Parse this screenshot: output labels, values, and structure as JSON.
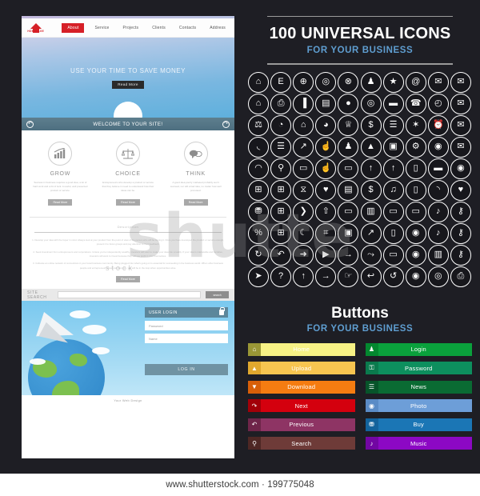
{
  "website": {
    "logo_text": "HOMEPAGE",
    "nav": [
      {
        "label": "About",
        "active": true
      },
      {
        "label": "Service",
        "active": false
      },
      {
        "label": "Projects",
        "active": false
      },
      {
        "label": "Clients",
        "active": false
      },
      {
        "label": "Contacts",
        "active": false
      },
      {
        "label": "Address",
        "active": false
      }
    ],
    "hero": {
      "title": "USE YOUR TIME TO SAVE MONEY",
      "button": "Read  More"
    },
    "welcome_bar": {
      "text": "WELCOME TO YOUR SITE!",
      "prev_icon": "arrow-left-circle-icon",
      "next_icon": "arrow-right-circle-icon"
    },
    "features": [
      {
        "title": "GROW",
        "icon": "bar-chart-growth-icon",
        "body": "Success in business requires a good idea, a lot of hard work and a bit of luck. A useful, well presented product or service.",
        "button": "Read More"
      },
      {
        "title": "CHOICE",
        "icon": "scales-balance-icon",
        "body": "Entrepreneurs who develop a product or service that they believe in need to understand how their ideas can be.",
        "button": "Read More"
      },
      {
        "title": "THINK",
        "icon": "speech-bubbles-icon",
        "body": "A good idea poorly marketed probably won't succeed, nor will a bad idea, no matter how well promoted.",
        "button": "Read More"
      }
    ],
    "article": {
      "heading": "Description",
      "paragraphs": [
        "1. Develop your idea with the buyer in mind. Always look at your product from the point of view of the person who will be buying it. Once you have developed the product or service enough, present it to focus groups and pay attention to their feedback.",
        "2. Seek investment from entrepreneurs and corporations. Unless you're independently wealthy, investors will want to make your idea into a reality. If your idea is marketable and lucrative, investors will want to invest because they will see profit in it for themselves.",
        "3. Cultivate an online network of connections in your local business community. Being plugged into what's going on is essential for succeeding in the business world. When other business people and entrepreneurs know and trust you, you will be in the loop when opportunities arise."
      ],
      "button": "Read More"
    },
    "site_search": {
      "label": "SITE  SEARCH",
      "input_value": "",
      "placeholder": "",
      "button": "search"
    },
    "login": {
      "header": "USER LOGIN",
      "lock_icon": "lock-icon",
      "password_placeholder": "Password",
      "name_placeholder": "Name",
      "submit": "LOG IN"
    },
    "footer": "Your  Web  Design"
  },
  "icons_section": {
    "title": "100 UNIVERSAL ICONS",
    "subtitle": "FOR YOUR BUSINESS",
    "accent_color": "#5f9ed1",
    "rows": [
      [
        "home-icon",
        "document-icon",
        "globe-grid-icon",
        "globe-icon",
        "globe-wire-icon",
        "users-group-icon",
        "award-badge-icon",
        "at-sign-icon",
        "mail-star-icon",
        "envelope-icon"
      ],
      [
        "home-alt-icon",
        "printer-doc-icon",
        "bar-chart-icon",
        "presentation-icon",
        "world-globe-icon",
        "target-icon",
        "briefcase-icon",
        "phone-icon",
        "clock-icon",
        "envelope-open-icon"
      ],
      [
        "scales-icon",
        "pie-doc-icon",
        "bank-icon",
        "pie-chart-icon",
        "trophy-icon",
        "money-bag-icon",
        "server-icon",
        "network-icon",
        "alarm-clock-icon",
        "mail-send-icon"
      ],
      [
        "rss-icon",
        "file-stack-icon",
        "rocket-launch-icon",
        "thumbs-up-icon",
        "user-tie-icon",
        "graduation-cap-icon",
        "photo-frame-icon",
        "gear-icon",
        "record-icon",
        "mail-plain-icon"
      ],
      [
        "wifi-icon",
        "search-doc-icon",
        "shopping-bag-icon",
        "thumb-up-alt-icon",
        "tv-icon",
        "rocket-icon",
        "missile-icon",
        "mobile-phone-icon",
        "bed-icon",
        "circle-dot-icon"
      ],
      [
        "gift-box-icon",
        "gift-icon",
        "hourglass-icon",
        "heart-icon",
        "bench-icon",
        "dollar-icon",
        "music-note-icon",
        "tablet-icon",
        "bathtub-icon",
        "heart-leaf-icon"
      ],
      [
        "shopping-cart-icon",
        "present-icon",
        "chevron-right-icon",
        "arrow-up-icon",
        "laptop-icon",
        "card-reader-icon",
        "monitor-icon",
        "notebook-icon",
        "headphones-icon",
        "key-icon"
      ],
      [
        "percent-icon",
        "gift-small-icon",
        "moon-icon",
        "grid-icon",
        "camera-square-icon",
        "arrow-diagonal-icon",
        "smartphone-icon",
        "camera-icon",
        "headset-icon",
        "key-alt-icon"
      ],
      [
        "refresh-icon",
        "undo-icon",
        "arrow-right-round-icon",
        "play-icon",
        "arrow-right-bar-icon",
        "arrow-curve-icon",
        "screen-icon",
        "photo-camera-icon",
        "cassette-icon",
        "key-hole-icon"
      ],
      [
        "cursor-icon",
        "question-icon",
        "arrow-up-line-icon",
        "arrow-right-line-icon",
        "hand-pointer-icon",
        "back-arrow-icon",
        "reload-icon",
        "camera-flash-icon",
        "video-camera-icon",
        "print-icon"
      ]
    ]
  },
  "buttons_section": {
    "title": "Buttons",
    "subtitle": "FOR YOUR BUSINESS",
    "left_column": [
      {
        "label": "Home",
        "icon": "home-icon",
        "body_color": "#f7f285",
        "icon_color": "#9a9736",
        "text_color": "#ffffff"
      },
      {
        "label": "Upload",
        "icon": "upload-icon",
        "body_color": "#f7c550",
        "icon_color": "#e0a82e",
        "text_color": "#ffffff"
      },
      {
        "label": "Download",
        "icon": "download-icon",
        "body_color": "#f57c11",
        "icon_color": "#d85f08",
        "text_color": "#ffffff"
      },
      {
        "label": "Next",
        "icon": "next-arrow-icon",
        "body_color": "#d4000e",
        "icon_color": "#a20008",
        "text_color": "#ffffff"
      },
      {
        "label": "Previous",
        "icon": "previous-arrow-icon",
        "body_color": "#8e3464",
        "icon_color": "#6e2549",
        "text_color": "#ffffff"
      },
      {
        "label": "Search",
        "icon": "search-icon",
        "body_color": "#6e3b38",
        "icon_color": "#4e2724",
        "text_color": "#ffffff"
      }
    ],
    "right_column": [
      {
        "label": "Login",
        "icon": "user-icon",
        "body_color": "#0aa13c",
        "icon_color": "#03882f",
        "text_color": "#ffffff"
      },
      {
        "label": "Password",
        "icon": "lock-icon",
        "body_color": "#0d8f5e",
        "icon_color": "#0a7a4d",
        "text_color": "#ffffff"
      },
      {
        "label": "News",
        "icon": "news-lines-icon",
        "body_color": "#0a6b33",
        "icon_color": "#07542a",
        "text_color": "#ffffff"
      },
      {
        "label": "Photo",
        "icon": "camera-icon",
        "body_color": "#6d9ed8",
        "icon_color": "#5a8bc6",
        "text_color": "#ffffff"
      },
      {
        "label": "Buy",
        "icon": "cart-icon",
        "body_color": "#1b76b5",
        "icon_color": "#13639c",
        "text_color": "#ffffff"
      },
      {
        "label": "Music",
        "icon": "headphones-icon",
        "body_color": "#8c08c4",
        "icon_color": "#7206a3",
        "text_color": "#ffffff"
      }
    ]
  },
  "watermark": {
    "big_text": "shutte",
    "small_text": "stock"
  },
  "footer": {
    "credit": "www.shutterstock.com · 199775048"
  }
}
